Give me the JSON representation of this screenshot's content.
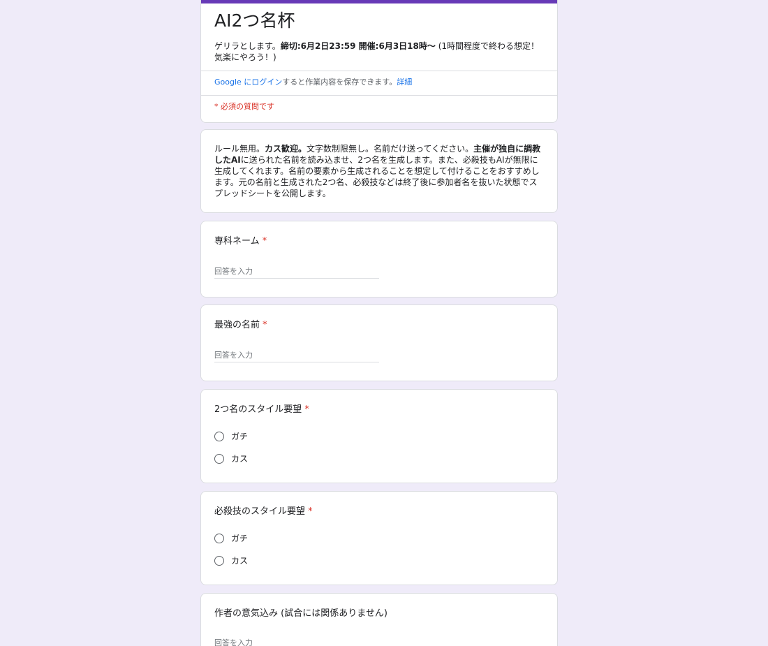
{
  "header": {
    "title": "AI2つ名杯",
    "desc_pre": "ゲリラとします。",
    "desc_bold": "締切:6月2日23:59 開催:6月3日18時〜",
    "desc_post": " (1時間程度で終わる想定！気楽にやろう！)",
    "login_google": "Google にログイン",
    "login_text": "すると作業内容を保存できます。",
    "login_detail": "詳細",
    "required_note": "* 必須の質問です"
  },
  "rules": {
    "p1": "ルール無用。",
    "b1": "カス歓迎。",
    "p2": "文字数制限無し。名前だけ送ってください。",
    "b2": "主催が独自に調教したAI",
    "p3": "に送られた名前を読み込ませ、2つ名を生成します。また、必殺技もAIが無限に生成してくれます。名前の要素から生成されることを想定して付けることをおすすめします。元の名前と生成された2つ名、必殺技などは終了後に参加者名を抜いた状態でスプレッドシートを公開します。"
  },
  "questions": {
    "q1": {
      "title": "専科ネーム",
      "required": "*",
      "placeholder": "回答を入力"
    },
    "q2": {
      "title": "最強の名前",
      "required": "*",
      "placeholder": "回答を入力"
    },
    "q3": {
      "title": "2つ名のスタイル要望",
      "required": "*",
      "options": [
        "ガチ",
        "カス"
      ]
    },
    "q4": {
      "title": "必殺技のスタイル要望",
      "required": "*",
      "options": [
        "ガチ",
        "カス"
      ]
    },
    "q5": {
      "title": "作者の意気込み (試合には関係ありません)",
      "placeholder": "回答を入力"
    }
  },
  "colors": {
    "background": "#efebf9",
    "accent": "#673ab7",
    "required": "#d93025",
    "link": "#1a73e8"
  }
}
